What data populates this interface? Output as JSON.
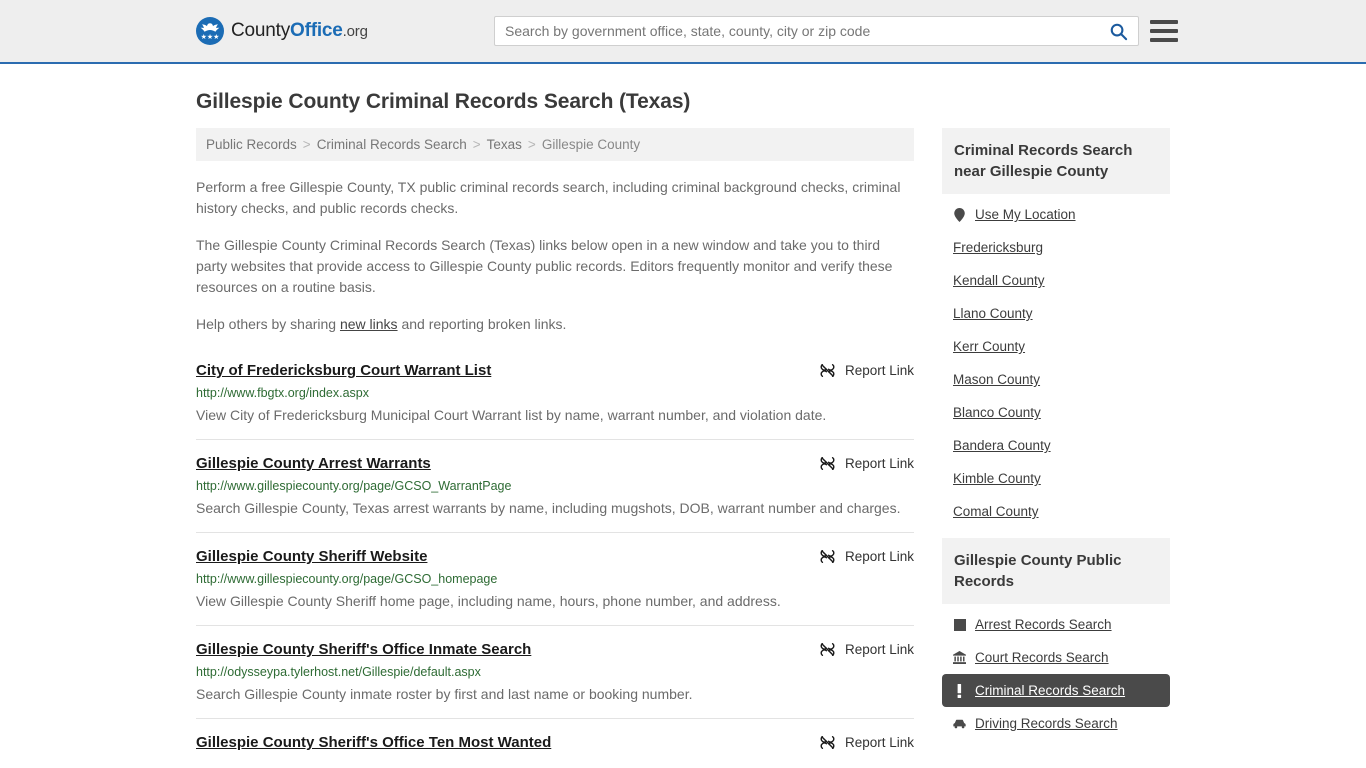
{
  "header": {
    "brand": {
      "part1": "County",
      "part2": "Office",
      "part3": ".org",
      "logo_icon": "eagle-shield-logo",
      "stars": "★★★"
    },
    "search": {
      "placeholder": "Search by government office, state, county, city or zip code",
      "value": "",
      "icon": "search-icon"
    },
    "menu_icon": "hamburger-menu-icon"
  },
  "page": {
    "title": "Gillespie County Criminal Records Search (Texas)"
  },
  "breadcrumb": {
    "items": [
      "Public Records",
      "Criminal Records Search",
      "Texas",
      "Gillespie County"
    ],
    "separator": ">"
  },
  "intro": {
    "p1": "Perform a free Gillespie County, TX public criminal records search, including criminal background checks, criminal history checks, and public records checks.",
    "p2": "The Gillespie County Criminal Records Search (Texas) links below open in a new window and take you to third party websites that provide access to Gillespie County public records. Editors frequently monitor and verify these resources on a routine basis.",
    "p3_before": "Help others by sharing ",
    "p3_link": "new links",
    "p3_after": " and reporting broken links."
  },
  "results": {
    "report_label": "Report Link",
    "report_icon": "broken-link-icon",
    "items": [
      {
        "title": "City of Fredericksburg Court Warrant List",
        "url": "http://www.fbgtx.org/index.aspx",
        "desc": "View City of Fredericksburg Municipal Court Warrant list by name, warrant number, and violation date."
      },
      {
        "title": "Gillespie County Arrest Warrants",
        "url": "http://www.gillespiecounty.org/page/GCSO_WarrantPage",
        "desc": "Search Gillespie County, Texas arrest warrants by name, including mugshots, DOB, warrant number and charges."
      },
      {
        "title": "Gillespie County Sheriff Website",
        "url": "http://www.gillespiecounty.org/page/GCSO_homepage",
        "desc": "View Gillespie County Sheriff home page, including name, hours, phone number, and address."
      },
      {
        "title": "Gillespie County Sheriff's Office Inmate Search",
        "url": "http://odysseypa.tylerhost.net/Gillespie/default.aspx",
        "desc": "Search Gillespie County inmate roster by first and last name or booking number."
      },
      {
        "title": "Gillespie County Sheriff's Office Ten Most Wanted",
        "url": "",
        "desc": ""
      }
    ]
  },
  "sidebar": {
    "nearby": {
      "heading": "Criminal Records Search near Gillespie County",
      "items": [
        {
          "label": "Use My Location",
          "icon": "map-pin-icon",
          "active": false
        },
        {
          "label": "Fredericksburg",
          "icon": "",
          "active": false
        },
        {
          "label": "Kendall County",
          "icon": "",
          "active": false
        },
        {
          "label": "Llano County",
          "icon": "",
          "active": false
        },
        {
          "label": "Kerr County",
          "icon": "",
          "active": false
        },
        {
          "label": "Mason County",
          "icon": "",
          "active": false
        },
        {
          "label": "Blanco County",
          "icon": "",
          "active": false
        },
        {
          "label": "Bandera County",
          "icon": "",
          "active": false
        },
        {
          "label": "Kimble County",
          "icon": "",
          "active": false
        },
        {
          "label": "Comal County",
          "icon": "",
          "active": false
        }
      ]
    },
    "public_records": {
      "heading": "Gillespie County Public Records",
      "items": [
        {
          "label": "Arrest Records Search",
          "icon": "square-icon",
          "active": false
        },
        {
          "label": "Court Records Search",
          "icon": "courthouse-icon",
          "active": false
        },
        {
          "label": "Criminal Records Search",
          "icon": "exclamation-icon",
          "active": true
        },
        {
          "label": "Driving Records Search",
          "icon": "car-icon",
          "active": false
        }
      ]
    }
  },
  "colors": {
    "brand_blue": "#1b6cb5",
    "header_bg": "#eeeeee",
    "url_green": "#2e6b34",
    "active_dark": "#4a4a4a",
    "panel_gray": "#f2f2f2"
  }
}
